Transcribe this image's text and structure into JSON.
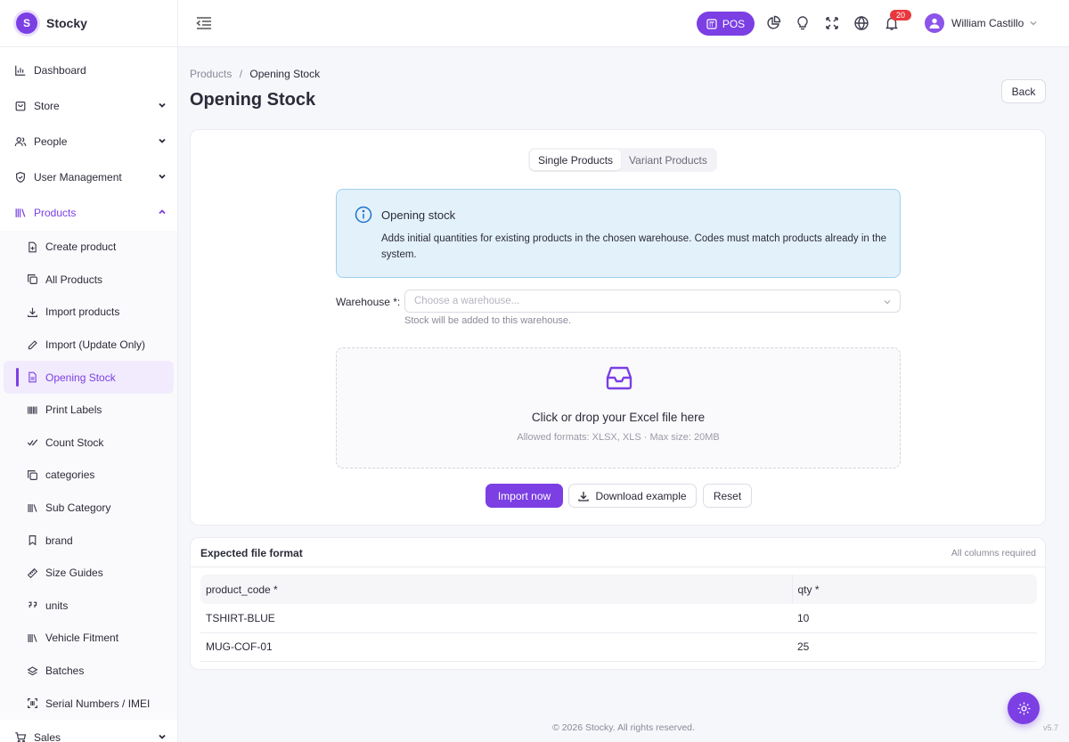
{
  "brand": {
    "name": "Stocky",
    "logo_letter": "S"
  },
  "sidebar": {
    "items": [
      {
        "label": "Dashboard",
        "icon": "bar-chart-icon"
      },
      {
        "label": "Store",
        "icon": "store-icon"
      },
      {
        "label": "People",
        "icon": "people-icon"
      },
      {
        "label": "User Management",
        "icon": "shield-icon"
      },
      {
        "label": "Products",
        "icon": "products-icon"
      }
    ],
    "products_sub": [
      {
        "label": "Create product",
        "icon": "file-plus-icon"
      },
      {
        "label": "All Products",
        "icon": "copy-icon"
      },
      {
        "label": "Import products",
        "icon": "download-icon"
      },
      {
        "label": "Import (Update Only)",
        "icon": "pencil-icon"
      },
      {
        "label": "Opening Stock",
        "icon": "file-icon"
      },
      {
        "label": "Print Labels",
        "icon": "barcode-icon"
      },
      {
        "label": "Count Stock",
        "icon": "check-icon"
      },
      {
        "label": "categories",
        "icon": "copy-icon"
      },
      {
        "label": "Sub Category",
        "icon": "books-icon"
      },
      {
        "label": "brand",
        "icon": "bookmark-icon"
      },
      {
        "label": "Size Guides",
        "icon": "ruler-icon"
      },
      {
        "label": "units",
        "icon": "units-icon"
      },
      {
        "label": "Vehicle Fitment",
        "icon": "books-icon"
      },
      {
        "label": "Batches",
        "icon": "layers-icon"
      },
      {
        "label": "Serial Numbers / IMEI",
        "icon": "scan-icon"
      }
    ],
    "bottom_item": {
      "label": "Sales",
      "icon": "cart-icon"
    }
  },
  "topbar": {
    "pos_label": "POS",
    "notification_count": "20",
    "user_name": "William Castillo"
  },
  "breadcrumb": {
    "parent": "Products",
    "separator": "/",
    "current": "Opening Stock"
  },
  "page": {
    "title": "Opening Stock",
    "back_label": "Back"
  },
  "tabs": {
    "single": "Single Products",
    "variant": "Variant Products"
  },
  "alert": {
    "title": "Opening stock",
    "description": "Adds initial quantities for existing products in the chosen warehouse. Codes must match products already in the system."
  },
  "warehouse": {
    "label": "Warehouse *:",
    "placeholder": "Choose a warehouse...",
    "help": "Stock will be added to this warehouse."
  },
  "upload": {
    "title": "Click or drop your Excel file here",
    "hint": "Allowed formats: XLSX, XLS · Max size: 20MB"
  },
  "actions": {
    "import": "Import now",
    "download": "Download example",
    "reset": "Reset"
  },
  "format": {
    "title": "Expected file format",
    "note": "All columns required",
    "columns": [
      "product_code *",
      "qty *"
    ],
    "rows": [
      [
        "TSHIRT-BLUE",
        "10"
      ],
      [
        "MUG-COF-01",
        "25"
      ]
    ]
  },
  "footer": {
    "copyright": "© 2026 Stocky. All rights reserved.",
    "version": "v5.7"
  },
  "colors": {
    "accent": "#7b3fe4",
    "alert_bg": "#e3f1fb",
    "alert_border": "#9fd1ef",
    "badge": "#e8383d"
  }
}
